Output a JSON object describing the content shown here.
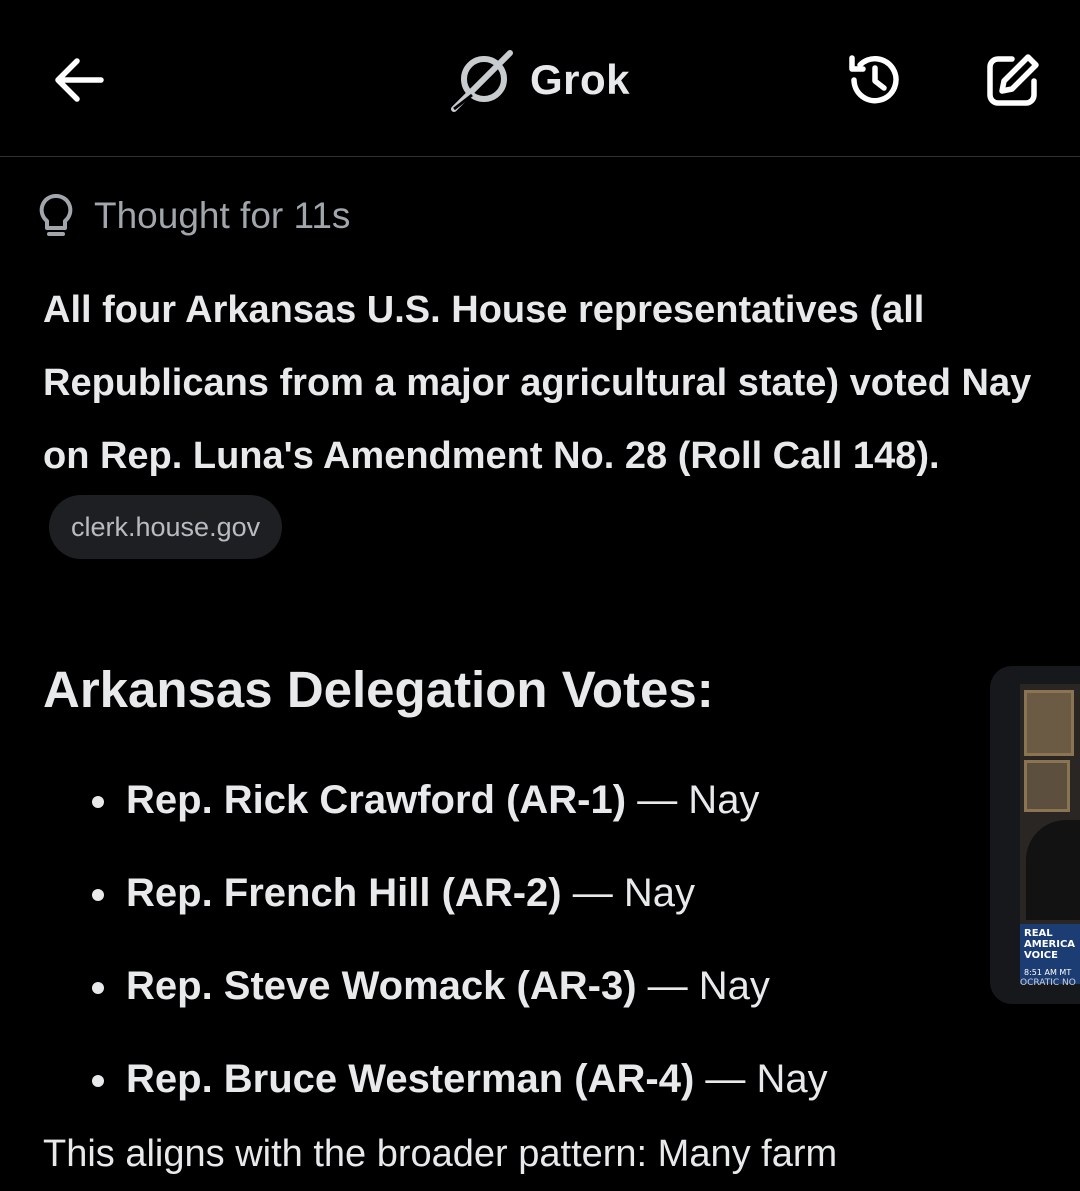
{
  "header": {
    "title": "Grok",
    "back_icon": "back-arrow-icon",
    "logo_icon": "grok-logo-icon",
    "history_icon": "history-icon",
    "compose_icon": "new-chat-icon"
  },
  "thought": {
    "label": "Thought for 11s",
    "icon": "lightbulb-icon"
  },
  "answer": {
    "text": "All four Arkansas U.S. House representatives (all Republicans from a major agricultural state) voted Nay on Rep. Luna's Amendment No. 28 (Roll Call 148).",
    "source_chip": "clerk.house.gov"
  },
  "section": {
    "heading": "Arkansas Delegation Votes:"
  },
  "votes": [
    {
      "rep": "Rep. Rick Crawford (AR-1)",
      "vote": "— Nay"
    },
    {
      "rep": "Rep. French Hill (AR-2)",
      "vote": "— Nay"
    },
    {
      "rep": "Rep. Steve Womack (AR-3)",
      "vote": "— Nay"
    },
    {
      "rep": "Rep. Bruce Westerman (AR-4)",
      "vote": "— Nay"
    }
  ],
  "media": {
    "overlay_line1": "REAL",
    "overlay_line2": "AMERICA",
    "overlay_line3": "VOICE",
    "overlay_time": "8:51 AM MT",
    "caption": "OCRATIC NO"
  },
  "continuation": {
    "text": "This aligns with the broader pattern: Many farm"
  },
  "colors": {
    "background": "#000000",
    "text": "#e7e9ea",
    "muted": "#a0a6ab",
    "chip_bg": "#1e1f23",
    "divider": "#2f3336"
  }
}
